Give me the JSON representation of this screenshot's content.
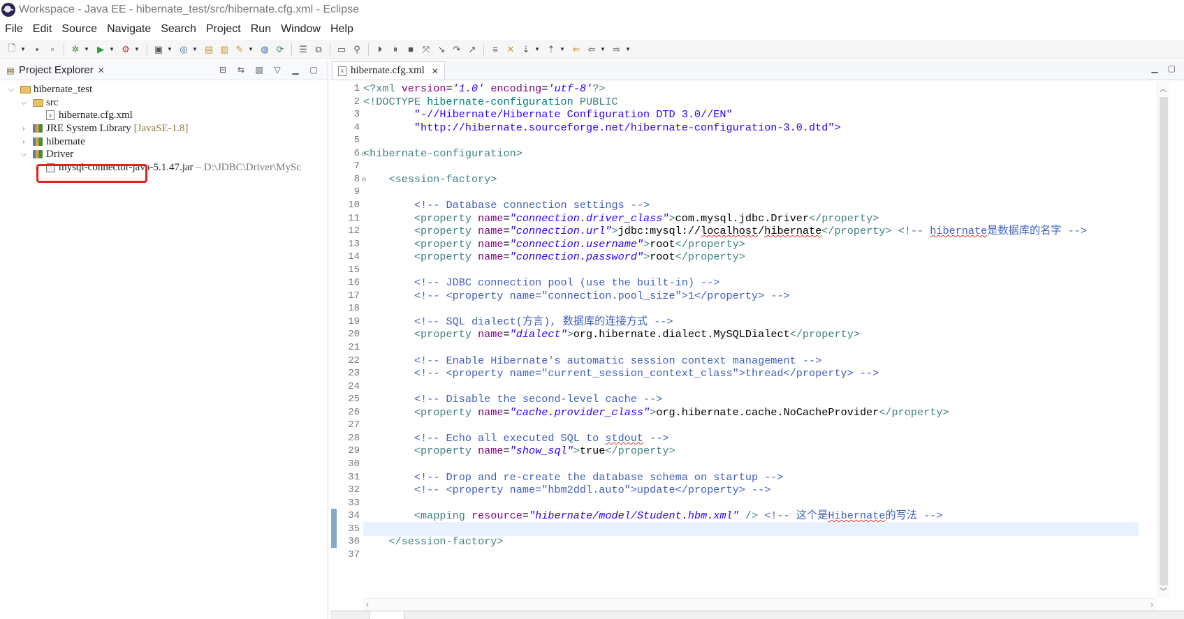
{
  "window": {
    "title": "Workspace - Java EE - hibernate_test/src/hibernate.cfg.xml - Eclipse"
  },
  "menubar": [
    "File",
    "Edit",
    "Source",
    "Navigate",
    "Search",
    "Project",
    "Run",
    "Window",
    "Help"
  ],
  "explorer": {
    "tab_label": "Project Explorer",
    "tree": [
      {
        "label": "hibernate_test",
        "icon": "project-icon",
        "state": "expanded"
      },
      {
        "label": "src",
        "icon": "package-folder-icon",
        "state": "expanded"
      },
      {
        "label": "hibernate.cfg.xml",
        "icon": "xml-file-icon",
        "selected_highlight": true
      },
      {
        "label": "JRE System Library",
        "extra": "[JavaSE-1.8]",
        "icon": "library-icon",
        "state": "collapsed"
      },
      {
        "label": "hibernate",
        "icon": "library-icon",
        "state": "collapsed"
      },
      {
        "label": "Driver",
        "icon": "library-icon",
        "state": "expanded"
      },
      {
        "label": "mysql-connector-java-5.1.47.jar",
        "extra": "– D:\\JDBC\\Driver\\MySc",
        "icon": "jar-icon",
        "state": "collapsed"
      }
    ]
  },
  "editor": {
    "tab_label": "hibernate.cfg.xml",
    "current_line": 35,
    "line_numbers": [
      "1",
      "2",
      "3",
      "4",
      "5",
      "6",
      "7",
      "8",
      "9",
      "10",
      "11",
      "12",
      "13",
      "14",
      "15",
      "16",
      "17",
      "18",
      "19",
      "20",
      "21",
      "22",
      "23",
      "24",
      "25",
      "26",
      "27",
      "28",
      "29",
      "30",
      "31",
      "32",
      "33",
      "34",
      "35",
      "36",
      "37"
    ],
    "lines": [
      [
        [
          "pi",
          "<?xml "
        ],
        [
          "an",
          "version"
        ],
        [
          "",
          "="
        ],
        [
          "av",
          "'1.0'"
        ],
        [
          "",
          ""
        ],
        [
          "an",
          " encoding"
        ],
        [
          "",
          "="
        ],
        [
          "av",
          "'utf-8'"
        ],
        [
          "pi",
          "?>"
        ]
      ],
      [
        [
          "tag",
          "<!DOCTYPE "
        ],
        [
          "dt",
          "hibernate-configuration"
        ],
        [
          "tag",
          " PUBLIC"
        ]
      ],
      [
        [
          "",
          "        "
        ],
        [
          "av-plain",
          "\"-//Hibernate/Hibernate Configuration DTD 3.0//EN\""
        ]
      ],
      [
        [
          "",
          "        "
        ],
        [
          "av-plain",
          "\"http://hibernate.sourceforge.net/hibernate-configuration-3.0.dtd\">"
        ]
      ],
      [],
      [
        [
          "tag",
          "<hibernate-configuration>"
        ]
      ],
      [],
      [
        [
          "",
          "    "
        ],
        [
          "tag",
          "<session-factory>"
        ]
      ],
      [],
      [
        [
          "",
          "        "
        ],
        [
          "cm",
          "<!-- Database connection settings -->"
        ]
      ],
      [
        [
          "",
          "        "
        ],
        [
          "tag",
          "<property "
        ],
        [
          "an",
          "name"
        ],
        [
          "",
          "="
        ],
        [
          "av",
          "\"connection.driver_class\""
        ],
        [
          "tag",
          ">"
        ],
        [
          "",
          "com.mysql.jdbc.Driver"
        ],
        [
          "tag",
          "</property>"
        ]
      ],
      [
        [
          "",
          "        "
        ],
        [
          "tag",
          "<property "
        ],
        [
          "an",
          "name"
        ],
        [
          "",
          "="
        ],
        [
          "av",
          "\"connection.url\""
        ],
        [
          "tag",
          ">"
        ],
        [
          "",
          "jdbc:mysql://"
        ],
        [
          "sq",
          "localhost"
        ],
        [
          "",
          "/"
        ],
        [
          "sq",
          "hibernate"
        ],
        [
          "tag",
          "</property>"
        ],
        [
          "cm",
          " <!-- "
        ],
        [
          "cm-sq",
          "hibernate"
        ],
        [
          "cm",
          "是数据库的名字 -->"
        ]
      ],
      [
        [
          "",
          "        "
        ],
        [
          "tag",
          "<property "
        ],
        [
          "an",
          "name"
        ],
        [
          "",
          "="
        ],
        [
          "av",
          "\"connection.username\""
        ],
        [
          "tag",
          ">"
        ],
        [
          "",
          "root"
        ],
        [
          "tag",
          "</property>"
        ]
      ],
      [
        [
          "",
          "        "
        ],
        [
          "tag",
          "<property "
        ],
        [
          "an",
          "name"
        ],
        [
          "",
          "="
        ],
        [
          "av",
          "\"connection.password\""
        ],
        [
          "tag",
          ">"
        ],
        [
          "",
          "root"
        ],
        [
          "tag",
          "</property>"
        ]
      ],
      [],
      [
        [
          "",
          "        "
        ],
        [
          "cm",
          "<!-- JDBC connection pool (use the built-in) -->"
        ]
      ],
      [
        [
          "",
          "        "
        ],
        [
          "cm",
          "<!-- <property name=\"connection.pool_size\">1</property> -->"
        ]
      ],
      [],
      [
        [
          "",
          "        "
        ],
        [
          "cm",
          "<!-- SQL dialect(方言), 数据库的连接方式 -->"
        ]
      ],
      [
        [
          "",
          "        "
        ],
        [
          "tag",
          "<property "
        ],
        [
          "an",
          "name"
        ],
        [
          "",
          "="
        ],
        [
          "av",
          "\"dialect\""
        ],
        [
          "tag",
          ">"
        ],
        [
          "",
          "org.hibernate.dialect.MySQLDialect"
        ],
        [
          "tag",
          "</property>"
        ]
      ],
      [],
      [
        [
          "",
          "        "
        ],
        [
          "cm",
          "<!-- Enable Hibernate's automatic session context management -->"
        ]
      ],
      [
        [
          "",
          "        "
        ],
        [
          "cm",
          "<!-- <property name=\"current_session_context_class\">thread</property> -->"
        ]
      ],
      [],
      [
        [
          "",
          "        "
        ],
        [
          "cm",
          "<!-- Disable the second-level cache -->"
        ]
      ],
      [
        [
          "",
          "        "
        ],
        [
          "tag",
          "<property "
        ],
        [
          "an",
          "name"
        ],
        [
          "",
          "="
        ],
        [
          "av",
          "\"cache.provider_class\""
        ],
        [
          "tag",
          ">"
        ],
        [
          "",
          "org.hibernate.cache.NoCacheProvider"
        ],
        [
          "tag",
          "</property>"
        ]
      ],
      [],
      [
        [
          "",
          "        "
        ],
        [
          "cm",
          "<!-- Echo all executed SQL to "
        ],
        [
          "cm-sq",
          "stdout"
        ],
        [
          "cm",
          " -->"
        ]
      ],
      [
        [
          "",
          "        "
        ],
        [
          "tag",
          "<property "
        ],
        [
          "an",
          "name"
        ],
        [
          "",
          "="
        ],
        [
          "av",
          "\"show_sql\""
        ],
        [
          "tag",
          ">"
        ],
        [
          "",
          "true"
        ],
        [
          "tag",
          "</property>"
        ]
      ],
      [],
      [
        [
          "",
          "        "
        ],
        [
          "cm",
          "<!-- Drop and re-create the database schema on startup -->"
        ]
      ],
      [
        [
          "",
          "        "
        ],
        [
          "cm",
          "<!-- <property name=\"hbm2ddl.auto\">update</property> -->"
        ]
      ],
      [],
      [
        [
          "",
          "        "
        ],
        [
          "tag",
          "<mapping "
        ],
        [
          "an",
          "resource"
        ],
        [
          "",
          "="
        ],
        [
          "av",
          "\"hibernate/model/Student.hbm.xml\""
        ],
        [
          "tag",
          " />"
        ],
        [
          "cm",
          " <!-- 这个是"
        ],
        [
          "cm-sq",
          "Hibernate"
        ],
        [
          "cm",
          "的写法 -->"
        ]
      ],
      [],
      [
        [
          "",
          "    "
        ],
        [
          "tag",
          "</session-factory>"
        ]
      ],
      []
    ]
  }
}
